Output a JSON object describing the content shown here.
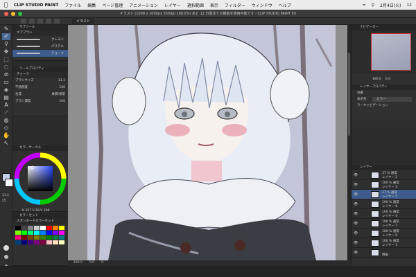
{
  "menubar": {
    "apple": "",
    "app_name": "CLIP STUDIO PAINT",
    "items": [
      "ファイル",
      "編集",
      "ページ管理",
      "アニメーション",
      "レイヤー",
      "選択範囲",
      "表示",
      "フィルター",
      "ウィンドウ",
      "ヘルプ"
    ],
    "date": "2月4日(火)",
    "time": "12"
  },
  "window": {
    "title": "イラスト (1000 x 1000px 350dpi 180.0%) あと 12 日間全ての機能を使用可能です - CLIP STUDIO PAINT EX",
    "canvas_tab": "イラスト"
  },
  "left": {
    "subtool_header": "サブツール",
    "brush_group": "エアブラシ",
    "brushes": [
      {
        "name": "クレヨン",
        "selected": false
      },
      {
        "name": "パステル",
        "selected": false
      },
      {
        "name": "チョーク",
        "selected": true
      }
    ],
    "tool_property_header": "ツールプロパティ",
    "tool_property_sub": "チョーク",
    "brush_size_label": "ブラシサイズ",
    "brush_size_value": "11.1",
    "opacity_label": "不透明度",
    "opacity_value": "100",
    "blend_label": "合成",
    "blend_value": "乗算/通常",
    "density_label": "ブラシ濃度",
    "density_value": "100",
    "color_circle_header": "カラーサークル",
    "color_values": "H 227  S 19  V 100",
    "color_set_header": "カラーセット",
    "color_set_name": "スタンダードカラーセット",
    "size_indicator": "11.1",
    "size_indicator_2": "25"
  },
  "status": {
    "zoom": "180.0",
    "angle": "0.0",
    "rotation": "0"
  },
  "right": {
    "navigator_header": "ナビゲーター",
    "nav_zoom": "180.0",
    "nav_angle": "0.0",
    "layer_property_header": "レイヤープロパティ",
    "effect_label": "効果",
    "display_color_label": "表示色",
    "display_color_value": "カラー",
    "tone_label": "ラーキャビゲーション",
    "layers_header": "レイヤー",
    "layers": [
      {
        "blend": "37 %  通常",
        "name": "レイヤー 2",
        "selected": false
      },
      {
        "blend": "100 %  通常",
        "name": "レイヤー 3",
        "selected": false
      },
      {
        "blend": "37 %  通常",
        "name": "レイヤー 5",
        "selected": true
      },
      {
        "blend": "100 %  通常",
        "name": "レイヤー 6",
        "selected": false
      },
      {
        "blend": "100 %  通常",
        "name": "レイヤー 4",
        "selected": false
      },
      {
        "blend": "100 %  通常",
        "name": "レイヤー 7",
        "selected": false
      },
      {
        "blend": "100 %  通常",
        "name": "レイヤー 8",
        "selected": false
      },
      {
        "blend": "100 %  通常",
        "name": "レイヤー 1",
        "selected": false
      },
      {
        "blend": "",
        "name": "用紙",
        "selected": false
      }
    ]
  },
  "colors": {
    "accent": "#3d5b8c",
    "main_color": "#c6d0ea",
    "sub_color": "#ffffff"
  }
}
